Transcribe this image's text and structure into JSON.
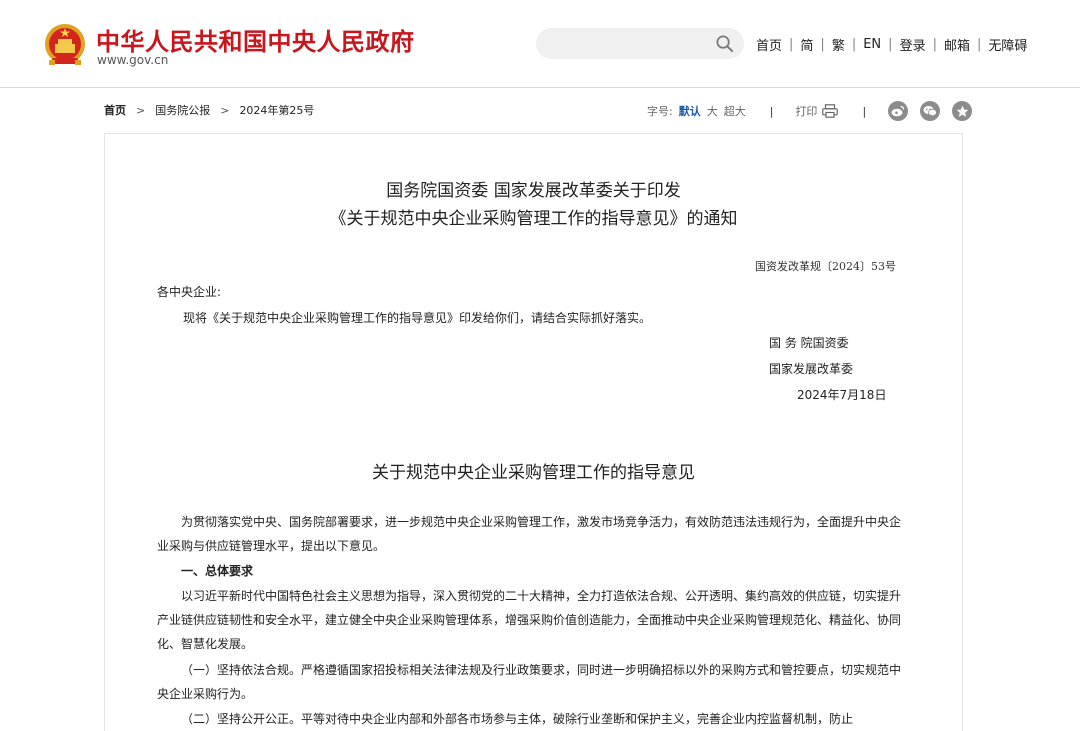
{
  "header": {
    "site_title": "中华人民共和国中央人民政府",
    "site_url": "www.gov.cn",
    "search": {
      "placeholder": ""
    },
    "nav": [
      "首页",
      "简",
      "繁",
      "EN",
      "登录",
      "邮箱",
      "无障碍"
    ],
    "nav_separator": "|"
  },
  "breadcrumb": {
    "items": [
      "首页",
      "国务院公报",
      "2024年第25号"
    ],
    "arrow": ">"
  },
  "toolbar": {
    "font_label": "字号:",
    "font_default": "默认",
    "font_large": "大",
    "font_xlarge": "超大",
    "divider": "|",
    "print_label": "打印"
  },
  "share_icons": [
    "weibo-icon",
    "wechat-icon",
    "favorite-icon"
  ],
  "article": {
    "title_line1": "国务院国资委  国家发展改革委关于印发",
    "title_line2": "《关于规范中央企业采购管理工作的指导意见》的通知",
    "doc_number": "国资发改革规〔2024〕53号",
    "salutation": "各中央企业:",
    "body_line": "现将《关于规范中央企业采购管理工作的指导意见》印发给你们，请结合实际抓好落实。",
    "signer1": "国 务 院国资委",
    "signer2": "国家发展改革委",
    "date": "2024年7月18日",
    "subtitle": "关于规范中央企业采购管理工作的指导意见",
    "intro": "为贯彻落实党中央、国务院部署要求，进一步规范中央企业采购管理工作，激发市场竞争活力，有效防范违法违规行为，全面提升中央企业采购与供应链管理水平，提出以下意见。",
    "section1_heading": "一、总体要求",
    "section1_text": "以习近平新时代中国特色社会主义思想为指导，深入贯彻党的二十大精神，全力打造依法合规、公开透明、集约高效的供应链，切实提升产业链供应链韧性和安全水平，建立健全中央企业采购管理体系，增强采购价值创造能力，全面推动中央企业采购管理规范化、精益化、协同化、智慧化发展。",
    "item1_heading": "（一）坚持依法合规。",
    "item1_text": "严格遵循国家招投标相关法律法规及行业政策要求，同时进一步明确招标以外的采购方式和管控要点，切实规范中央企业采购行为。",
    "item2_heading": "（二）坚持公开公正。",
    "item2_text": "平等对待中央企业内部和外部各市场参与主体，破除行业垄断和保护主义，完善企业内控监督机制，防止"
  },
  "colors": {
    "brand_red": "#c8161d",
    "link_blue": "#1c5fa8",
    "icon_gray": "#8c8c8c"
  }
}
